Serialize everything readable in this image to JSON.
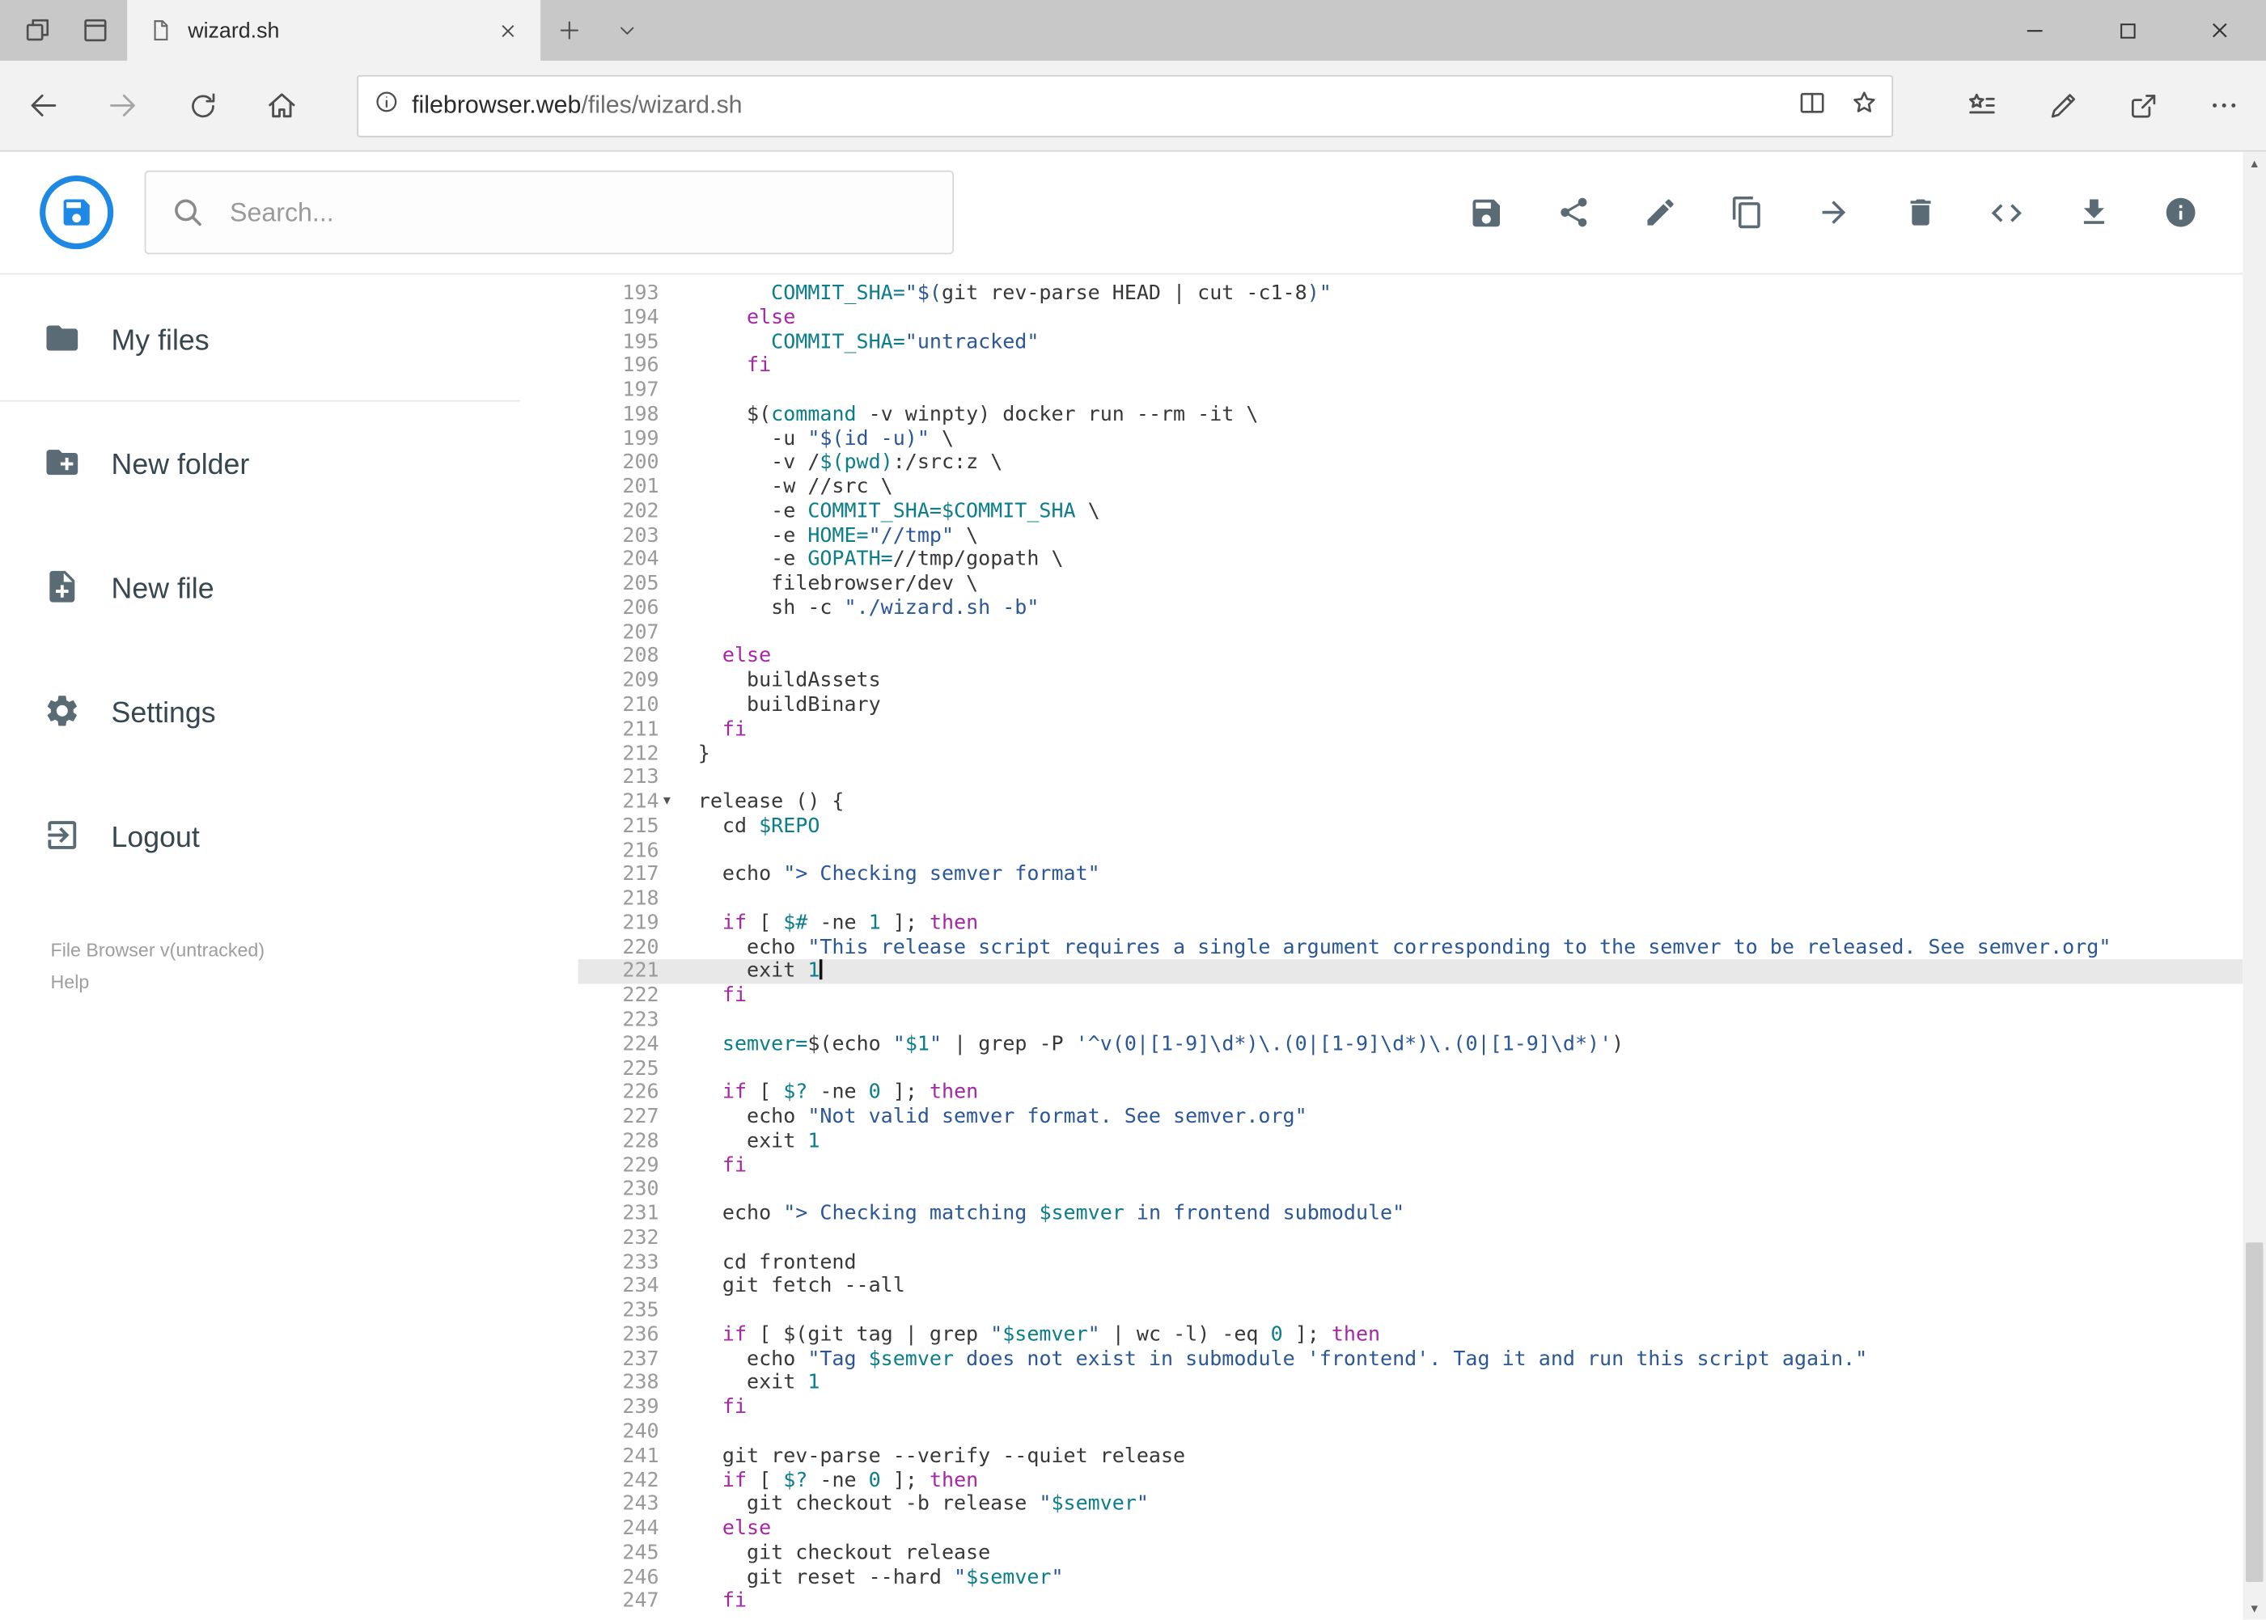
{
  "browser": {
    "tab_title": "wizard.sh",
    "url": {
      "domain": "filebrowser.web",
      "path": "/files/wizard.sh"
    },
    "icons": [
      "set-aside-tabs-icon",
      "show-set-aside-tabs-icon",
      "page-icon",
      "close-tab-icon",
      "new-tab-icon",
      "tab-dropdown-icon",
      "minimize-icon",
      "maximize-icon",
      "close-window-icon",
      "back-icon",
      "forward-icon",
      "refresh-icon",
      "home-icon",
      "page-info-icon",
      "reading-view-icon",
      "favorite-star-icon",
      "hub-icon",
      "web-note-icon",
      "share-icon",
      "more-icon"
    ]
  },
  "app": {
    "search_placeholder": "Search...",
    "toolbar_icons": [
      "save-icon",
      "share-icon",
      "rename-icon",
      "copy-icon",
      "move-icon",
      "delete-icon",
      "code-icon",
      "download-icon",
      "info-icon"
    ],
    "sidebar": {
      "items": [
        {
          "label": "My files",
          "icon": "folder-icon"
        },
        {
          "label": "New folder",
          "icon": "folder-plus-icon"
        },
        {
          "label": "New file",
          "icon": "file-plus-icon"
        },
        {
          "label": "Settings",
          "icon": "gear-icon"
        },
        {
          "label": "Logout",
          "icon": "logout-icon"
        }
      ],
      "footer_line1": "File Browser v(untracked)",
      "footer_line2": "Help"
    }
  },
  "colors": {
    "accent_blue": "#1e88e5",
    "keyword": "#a626a4",
    "variable": "#0c7e8a",
    "string": "#2b5797",
    "icon_gray": "#5a6b75",
    "active_line": "#e8e8e8"
  },
  "editor": {
    "lines": [
      {
        "n": 193,
        "t": [
          [
            "p",
            "      "
          ],
          [
            "v",
            "COMMIT_SHA="
          ],
          [
            "s",
            "\"$("
          ],
          [
            "p",
            "git rev-parse HEAD | cut -c1-8"
          ],
          [
            "s",
            ")\""
          ]
        ]
      },
      {
        "n": 194,
        "t": [
          [
            "p",
            "    "
          ],
          [
            "k",
            "else"
          ]
        ]
      },
      {
        "n": 195,
        "t": [
          [
            "p",
            "      "
          ],
          [
            "v",
            "COMMIT_SHA="
          ],
          [
            "s",
            "\"untracked\""
          ]
        ]
      },
      {
        "n": 196,
        "t": [
          [
            "p",
            "    "
          ],
          [
            "k",
            "fi"
          ]
        ]
      },
      {
        "n": 197,
        "t": []
      },
      {
        "n": 198,
        "t": [
          [
            "p",
            "    $("
          ],
          [
            "v",
            "command"
          ],
          [
            "p",
            " -v winpty) docker run --rm -it \\"
          ]
        ]
      },
      {
        "n": 199,
        "t": [
          [
            "p",
            "      -u "
          ],
          [
            "s",
            "\"$(id -u)\""
          ],
          [
            "p",
            " \\"
          ]
        ]
      },
      {
        "n": 200,
        "t": [
          [
            "p",
            "      -v /"
          ],
          [
            "v",
            "$(pwd)"
          ],
          [
            "p",
            ":/src:z \\"
          ]
        ]
      },
      {
        "n": 201,
        "t": [
          [
            "p",
            "      -w //src \\"
          ]
        ]
      },
      {
        "n": 202,
        "t": [
          [
            "p",
            "      -e "
          ],
          [
            "v",
            "COMMIT_SHA=$COMMIT_SHA"
          ],
          [
            "p",
            " \\"
          ]
        ]
      },
      {
        "n": 203,
        "t": [
          [
            "p",
            "      -e "
          ],
          [
            "v",
            "HOME="
          ],
          [
            "s",
            "\"//tmp\""
          ],
          [
            "p",
            " \\"
          ]
        ]
      },
      {
        "n": 204,
        "t": [
          [
            "p",
            "      -e "
          ],
          [
            "v",
            "GOPATH="
          ],
          [
            "p",
            "//tmp/gopath \\"
          ]
        ]
      },
      {
        "n": 205,
        "t": [
          [
            "p",
            "      filebrowser/dev \\"
          ]
        ]
      },
      {
        "n": 206,
        "t": [
          [
            "p",
            "      sh -c "
          ],
          [
            "s",
            "\"./wizard.sh -b\""
          ]
        ]
      },
      {
        "n": 207,
        "t": []
      },
      {
        "n": 208,
        "t": [
          [
            "p",
            "  "
          ],
          [
            "k",
            "else"
          ]
        ]
      },
      {
        "n": 209,
        "t": [
          [
            "p",
            "    buildAssets"
          ]
        ]
      },
      {
        "n": 210,
        "t": [
          [
            "p",
            "    buildBinary"
          ]
        ]
      },
      {
        "n": 211,
        "t": [
          [
            "p",
            "  "
          ],
          [
            "k",
            "fi"
          ]
        ]
      },
      {
        "n": 212,
        "t": [
          [
            "p",
            "}"
          ]
        ]
      },
      {
        "n": 213,
        "t": []
      },
      {
        "n": 214,
        "fold": true,
        "t": [
          [
            "p",
            "release () {"
          ]
        ]
      },
      {
        "n": 215,
        "t": [
          [
            "p",
            "  cd "
          ],
          [
            "v",
            "$REPO"
          ]
        ]
      },
      {
        "n": 216,
        "t": []
      },
      {
        "n": 217,
        "t": [
          [
            "p",
            "  echo "
          ],
          [
            "s",
            "\"> Checking semver format\""
          ]
        ]
      },
      {
        "n": 218,
        "t": []
      },
      {
        "n": 219,
        "t": [
          [
            "p",
            "  "
          ],
          [
            "k",
            "if"
          ],
          [
            "p",
            " [ "
          ],
          [
            "v",
            "$#"
          ],
          [
            "p",
            " -ne "
          ],
          [
            "n2",
            "1"
          ],
          [
            "p",
            " ]; "
          ],
          [
            "k",
            "then"
          ]
        ]
      },
      {
        "n": 220,
        "t": [
          [
            "p",
            "    echo "
          ],
          [
            "s",
            "\"This release script requires a single argument corresponding to the semver to be released. See semver.org\""
          ]
        ]
      },
      {
        "n": 221,
        "active": true,
        "cursor": true,
        "t": [
          [
            "p",
            "    exit "
          ],
          [
            "n2",
            "1"
          ]
        ]
      },
      {
        "n": 222,
        "t": [
          [
            "p",
            "  "
          ],
          [
            "k",
            "fi"
          ]
        ]
      },
      {
        "n": 223,
        "t": []
      },
      {
        "n": 224,
        "t": [
          [
            "p",
            "  "
          ],
          [
            "v",
            "semver="
          ],
          [
            "p",
            "$(echo "
          ],
          [
            "s",
            "\""
          ],
          [
            "v",
            "$1"
          ],
          [
            "s",
            "\""
          ],
          [
            "p",
            " | grep -P "
          ],
          [
            "s",
            "'^v(0|[1-9]\\d*)\\.(0|[1-9]\\d*)\\.(0|[1-9]\\d*)'"
          ],
          [
            "p",
            ")"
          ]
        ]
      },
      {
        "n": 225,
        "t": []
      },
      {
        "n": 226,
        "t": [
          [
            "p",
            "  "
          ],
          [
            "k",
            "if"
          ],
          [
            "p",
            " [ "
          ],
          [
            "v",
            "$?"
          ],
          [
            "p",
            " -ne "
          ],
          [
            "n2",
            "0"
          ],
          [
            "p",
            " ]; "
          ],
          [
            "k",
            "then"
          ]
        ]
      },
      {
        "n": 227,
        "t": [
          [
            "p",
            "    echo "
          ],
          [
            "s",
            "\"Not valid semver format. See semver.org\""
          ]
        ]
      },
      {
        "n": 228,
        "t": [
          [
            "p",
            "    exit "
          ],
          [
            "n2",
            "1"
          ]
        ]
      },
      {
        "n": 229,
        "t": [
          [
            "p",
            "  "
          ],
          [
            "k",
            "fi"
          ]
        ]
      },
      {
        "n": 230,
        "t": []
      },
      {
        "n": 231,
        "t": [
          [
            "p",
            "  echo "
          ],
          [
            "s",
            "\"> Checking matching "
          ],
          [
            "v",
            "$semver"
          ],
          [
            "s",
            " in frontend submodule\""
          ]
        ]
      },
      {
        "n": 232,
        "t": []
      },
      {
        "n": 233,
        "t": [
          [
            "p",
            "  cd frontend"
          ]
        ]
      },
      {
        "n": 234,
        "t": [
          [
            "p",
            "  git fetch --all"
          ]
        ]
      },
      {
        "n": 235,
        "t": []
      },
      {
        "n": 236,
        "t": [
          [
            "p",
            "  "
          ],
          [
            "k",
            "if"
          ],
          [
            "p",
            " [ $(git tag | grep "
          ],
          [
            "s",
            "\""
          ],
          [
            "v",
            "$semver"
          ],
          [
            "s",
            "\""
          ],
          [
            "p",
            " | wc -l) -eq "
          ],
          [
            "n2",
            "0"
          ],
          [
            "p",
            " ]; "
          ],
          [
            "k",
            "then"
          ]
        ]
      },
      {
        "n": 237,
        "t": [
          [
            "p",
            "    echo "
          ],
          [
            "s",
            "\"Tag "
          ],
          [
            "v",
            "$semver"
          ],
          [
            "s",
            " does not exist in submodule 'frontend'. Tag it and run this script again.\""
          ]
        ]
      },
      {
        "n": 238,
        "t": [
          [
            "p",
            "    exit "
          ],
          [
            "n2",
            "1"
          ]
        ]
      },
      {
        "n": 239,
        "t": [
          [
            "p",
            "  "
          ],
          [
            "k",
            "fi"
          ]
        ]
      },
      {
        "n": 240,
        "t": []
      },
      {
        "n": 241,
        "t": [
          [
            "p",
            "  git rev-parse --verify --quiet release"
          ]
        ]
      },
      {
        "n": 242,
        "t": [
          [
            "p",
            "  "
          ],
          [
            "k",
            "if"
          ],
          [
            "p",
            " [ "
          ],
          [
            "v",
            "$?"
          ],
          [
            "p",
            " -ne "
          ],
          [
            "n2",
            "0"
          ],
          [
            "p",
            " ]; "
          ],
          [
            "k",
            "then"
          ]
        ]
      },
      {
        "n": 243,
        "t": [
          [
            "p",
            "    git checkout -b release "
          ],
          [
            "s",
            "\""
          ],
          [
            "v",
            "$semver"
          ],
          [
            "s",
            "\""
          ]
        ]
      },
      {
        "n": 244,
        "t": [
          [
            "p",
            "  "
          ],
          [
            "k",
            "else"
          ]
        ]
      },
      {
        "n": 245,
        "t": [
          [
            "p",
            "    git checkout release"
          ]
        ]
      },
      {
        "n": 246,
        "t": [
          [
            "p",
            "    git reset --hard "
          ],
          [
            "s",
            "\""
          ],
          [
            "v",
            "$semver"
          ],
          [
            "s",
            "\""
          ]
        ]
      },
      {
        "n": 247,
        "t": [
          [
            "p",
            "  "
          ],
          [
            "k",
            "fi"
          ]
        ]
      }
    ]
  }
}
